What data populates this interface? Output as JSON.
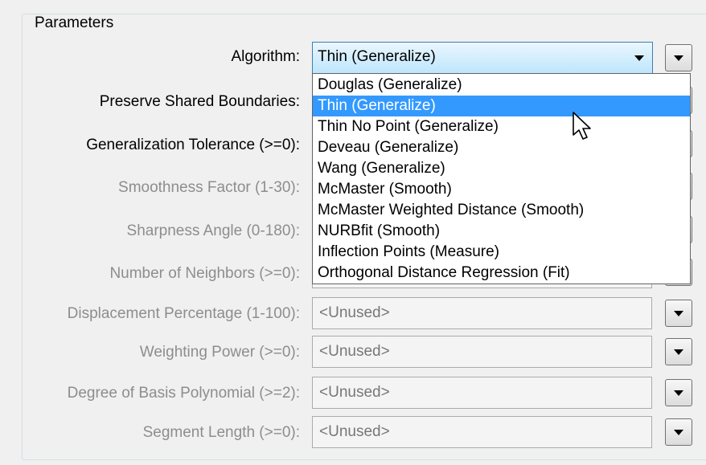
{
  "panel": {
    "title": "Parameters"
  },
  "algorithm": {
    "label": "Algorithm:",
    "value": "Thin (Generalize)",
    "options": [
      "Douglas (Generalize)",
      "Thin (Generalize)",
      "Thin No Point (Generalize)",
      "Deveau (Generalize)",
      "Wang (Generalize)",
      "McMaster (Smooth)",
      "McMaster Weighted Distance (Smooth)",
      "NURBfit (Smooth)",
      "Inflection Points (Measure)",
      "Orthogonal Distance Regression (Fit)"
    ],
    "selected_index": 1
  },
  "params": [
    {
      "id": "preserve-shared-boundaries",
      "label": "Preserve Shared Boundaries:",
      "enabled": true
    },
    {
      "id": "generalization-tolerance",
      "label": "Generalization Tolerance (>=0):",
      "enabled": true
    },
    {
      "id": "smoothness-factor",
      "label": "Smoothness Factor (1-30):",
      "enabled": false
    },
    {
      "id": "sharpness-angle",
      "label": "Sharpness Angle (0-180):",
      "enabled": false
    },
    {
      "id": "number-of-neighbors",
      "label": "Number of Neighbors (>=0):",
      "enabled": false
    },
    {
      "id": "displacement-percentage",
      "label": "Displacement Percentage (1-100):",
      "enabled": false,
      "value": "<Unused>"
    },
    {
      "id": "weighting-power",
      "label": "Weighting Power (>=0):",
      "enabled": false,
      "value": "<Unused>"
    },
    {
      "id": "degree-of-basis-polynomial",
      "label": "Degree of Basis Polynomial (>=2):",
      "enabled": false,
      "value": "<Unused>"
    },
    {
      "id": "segment-length",
      "label": "Segment Length (>=0):",
      "enabled": false,
      "value": "<Unused>"
    }
  ],
  "icons": {
    "combo_arrow": "chevron-down-icon",
    "menu_button": "triangle-down-icon",
    "cursor": "mouse-pointer-icon"
  },
  "colors": {
    "selection": "#3399ff",
    "combo_border": "#3c7fb1",
    "disabled_text": "#8d8d8d"
  }
}
